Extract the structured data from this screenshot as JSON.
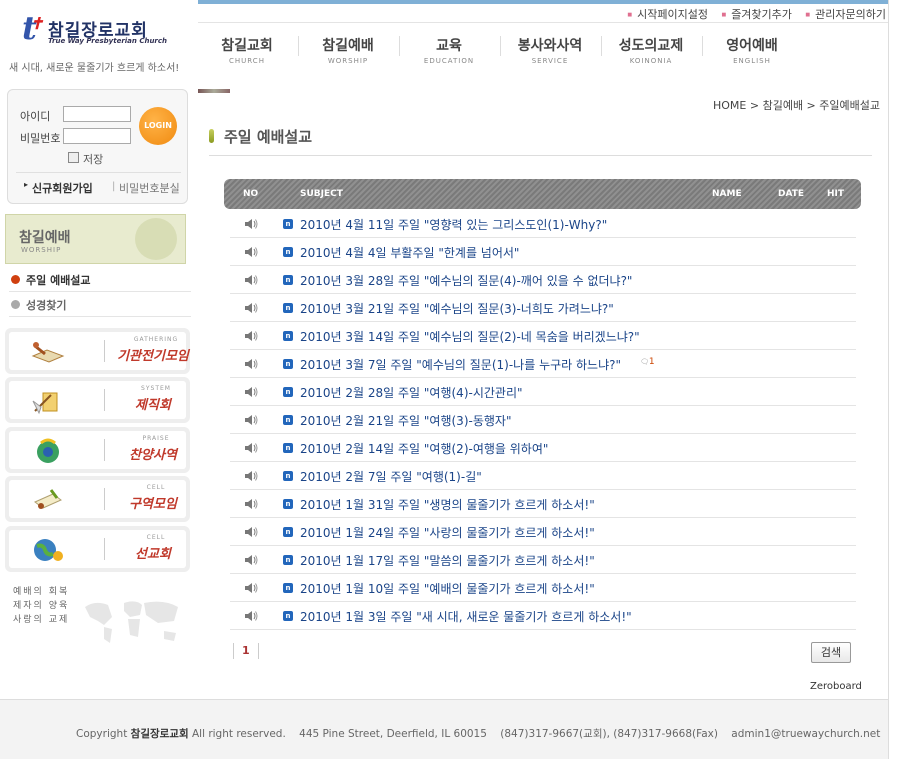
{
  "logo": {
    "name": "참길장로교회",
    "sub": "True Way Presbyterian Church"
  },
  "slogan": "새 시대, 새로운 물줄기가 흐르게 하소서!",
  "login": {
    "id_label": "아이디",
    "pw_label": "비밀번호",
    "button": "LOGIN",
    "save_label": "저장",
    "join": "신규회원가입",
    "separator": "|",
    "find_pw": "비밀번호분실"
  },
  "section": {
    "title": "참길예배",
    "sub": "WORSHIP"
  },
  "submenu": [
    {
      "label": "주일 예배설교",
      "color": "#333"
    },
    {
      "label": "성경찾기",
      "color": "#666"
    }
  ],
  "menuboxes": [
    {
      "en": "GATHERING",
      "ko": "기관전기모임",
      "icon": "book-icon"
    },
    {
      "en": "SYSTEM",
      "ko": "제직회",
      "icon": "quill-icon"
    },
    {
      "en": "PRAISE",
      "ko": "찬양사역",
      "icon": "music-icon"
    },
    {
      "en": "CELL",
      "ko": "구역모임",
      "icon": "scroll-icon"
    },
    {
      "en": "CELL",
      "ko": "선교회",
      "icon": "globe-icon"
    }
  ],
  "motto": [
    "예배의 회복",
    "제자의 양육",
    "사랑의 교제"
  ],
  "quicklinks": [
    "시작페이지설정",
    "즐겨찾기추가",
    "관리자문의하기"
  ],
  "nav": [
    {
      "ko": "참길교회",
      "en": "CHURCH"
    },
    {
      "ko": "참길예배",
      "en": "WORSHIP"
    },
    {
      "ko": "교육",
      "en": "EDUCATION"
    },
    {
      "ko": "봉사와사역",
      "en": "SERVICE"
    },
    {
      "ko": "성도의교제",
      "en": "KOINONIA"
    },
    {
      "ko": "영어예배",
      "en": "ENGLISH"
    }
  ],
  "breadcrumb": "HOME > 참길예배 > 주일예배설교",
  "page_title": "주일 예배설교",
  "board": {
    "headers": {
      "no": "NO",
      "subject": "SUBJECT",
      "name": "NAME",
      "date": "DATE",
      "hit": "HIT"
    },
    "rows": [
      {
        "subject": "2010년 4월 11일 주일 \"영향력 있는 그리스도인(1)-Why?\""
      },
      {
        "subject": "2010년 4월 4일 부활주일 \"한계를 넘어서\""
      },
      {
        "subject": "2010년 3월 28일 주일 \"예수님의 질문(4)-깨어 있을 수 없더냐?\""
      },
      {
        "subject": "2010년 3월 21일 주일 \"예수님의 질문(3)-너희도 가려느냐?\""
      },
      {
        "subject": "2010년 3월 14일 주일 \"예수님의 질문(2)-네 목숨을 버리겠느냐?\""
      },
      {
        "subject": "2010년 3월 7일 주일 \"예수님의 질문(1)-나를 누구라 하느냐?\"",
        "comments": "1"
      },
      {
        "subject": "2010년 2월 28일 주일 \"여행(4)-시간관리\""
      },
      {
        "subject": "2010년 2월 21일 주일 \"여행(3)-동행자\""
      },
      {
        "subject": "2010년 2월 14일 주일 \"여행(2)-여행을 위하여\""
      },
      {
        "subject": "2010년 2월 7일 주일 \"여행(1)-길\""
      },
      {
        "subject": "2010년 1월 31일 주일 \"생명의 물줄기가 흐르게 하소서!\""
      },
      {
        "subject": "2010년 1월 24일 주일 \"사랑의 물줄기가 흐르게 하소서!\""
      },
      {
        "subject": "2010년 1월 17일 주일 \"말씀의 물줄기가 흐르게 하소서!\""
      },
      {
        "subject": "2010년 1월 10일 주일 \"예배의 물줄기가 흐르게 하소서!\""
      },
      {
        "subject": "2010년 1월 3일 주일 \"새 시대, 새로운 물줄기가 흐르게 하소서!\""
      }
    ],
    "page": "1",
    "search_label": "검색",
    "powered_by": "Zeroboard"
  },
  "footer": {
    "copyright": "Copyright",
    "church": "참길장로교회",
    "rest": "All right reserved.    445 Pine Street, Deerfield, IL 60015    (847)317-9667(교회), (847)317-9668(Fax)    admin1@truewaychurch.net"
  },
  "colors": {
    "accent": "#1a4488",
    "top_bar": "#7fb0d6",
    "login_button": "#f08a10",
    "menu_ko": "#c0392b"
  }
}
